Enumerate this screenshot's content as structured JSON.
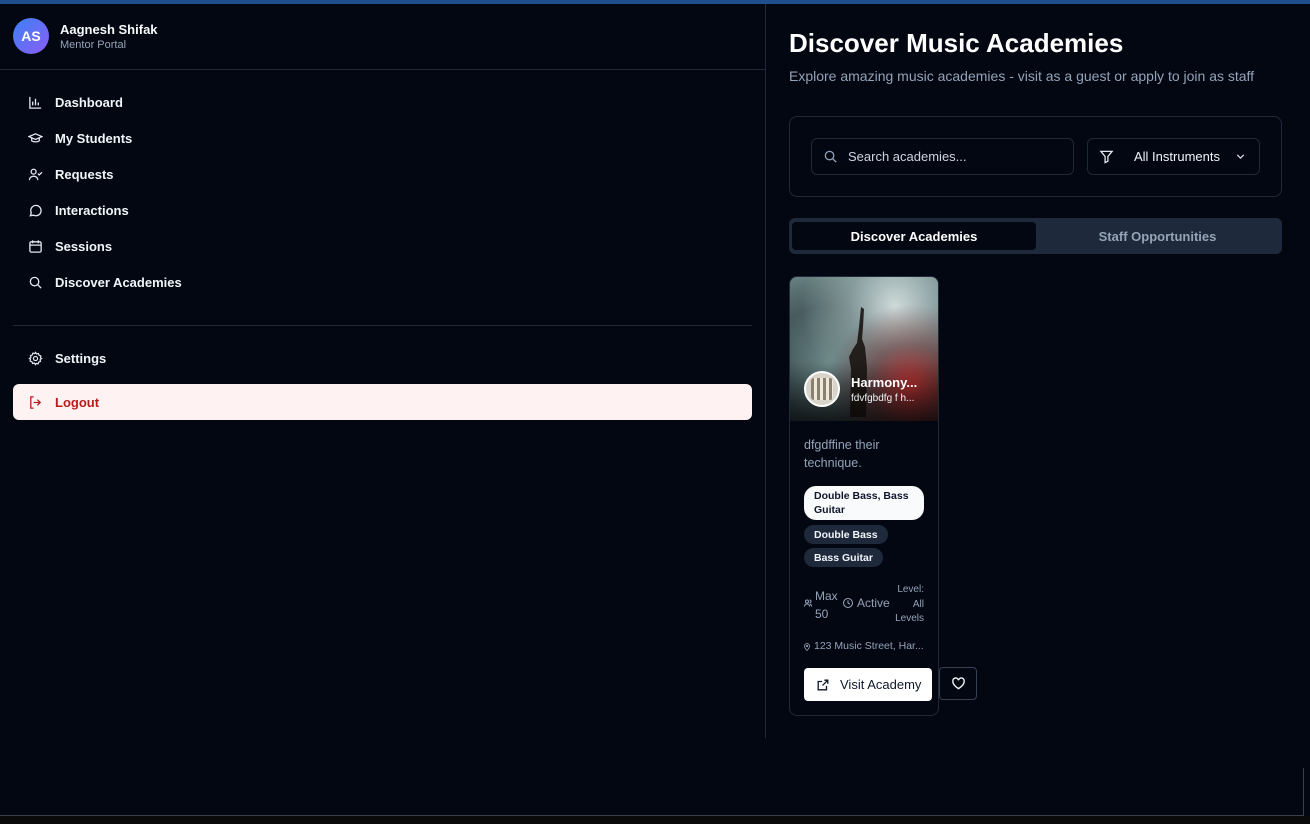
{
  "user": {
    "initials": "AS",
    "name": "Aagnesh Shifak",
    "role": "Mentor Portal"
  },
  "nav": {
    "items": [
      {
        "label": "Dashboard",
        "icon": "bar-chart-icon"
      },
      {
        "label": "My Students",
        "icon": "graduation-cap-icon"
      },
      {
        "label": "Requests",
        "icon": "user-check-icon"
      },
      {
        "label": "Interactions",
        "icon": "message-circle-icon"
      },
      {
        "label": "Sessions",
        "icon": "calendar-icon"
      },
      {
        "label": "Discover Academies",
        "icon": "search-icon"
      }
    ],
    "settings": "Settings",
    "logout": "Logout"
  },
  "page": {
    "title": "Discover Music Academies",
    "subtitle": "Explore amazing music academies - visit as a guest or apply to join as staff"
  },
  "filters": {
    "search_placeholder": "Search academies...",
    "instrument_selected": "All Instruments"
  },
  "tabs": [
    {
      "label": "Discover Academies",
      "active": true
    },
    {
      "label": "Staff Opportunities",
      "active": false
    }
  ],
  "academies": [
    {
      "name": "Harmony...",
      "tagline": "fdvfgbdfg f h...",
      "description": "dfgdffine their technique.",
      "instruments_primary": "Double Bass, Bass Guitar",
      "instruments": [
        "Double Bass",
        "Bass Guitar"
      ],
      "capacity": "Max 50",
      "status": "Active",
      "level": "Level: All Levels",
      "address": "123 Music Street, Har...",
      "visit_label": "Visit Academy"
    }
  ],
  "colors": {
    "background": "#030712",
    "logout_bg": "#fef2f2",
    "logout_text": "#b91c1c",
    "avatar_gradient_start": "#3b82f6",
    "avatar_gradient_end": "#8b5cf6"
  }
}
